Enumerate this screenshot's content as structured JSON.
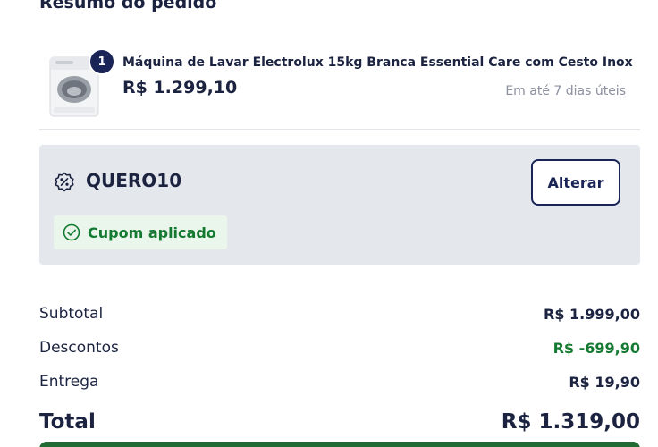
{
  "order_summary": {
    "title": "Resumo do pedido"
  },
  "product": {
    "quantity": "1",
    "name": "Máquina de Lavar Electrolux 15kg Branca Essential Care com Cesto Inox",
    "price": "R$ 1.299,10",
    "delivery": "Em até 7 dias úteis",
    "image_icon": "washing-machine-icon"
  },
  "coupon": {
    "icon": "percent-badge-icon",
    "code": "QUERO10",
    "change_label": "Alterar",
    "applied_icon": "check-circle-icon",
    "applied_label": "Cupom aplicado"
  },
  "totals": {
    "subtotal_label": "Subtotal",
    "subtotal_value": "R$ 1.999,00",
    "discounts_label": "Descontos",
    "discounts_value": "R$ -699,90",
    "delivery_label": "Entrega",
    "delivery_value": "R$ 19,90",
    "total_label": "Total",
    "total_value": "R$ 1.319,00"
  },
  "colors": {
    "brand_navy": "#1b2456",
    "success_green": "#157a31",
    "coupon_bg": "#e4e7ec",
    "cta_green": "#1f6b33"
  }
}
